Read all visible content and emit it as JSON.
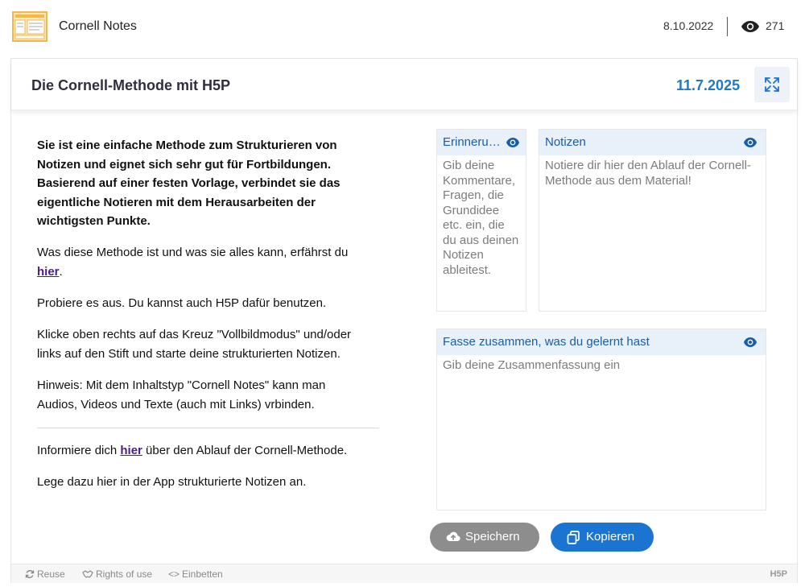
{
  "header": {
    "app_title": "Cornell Notes",
    "date": "8.10.2022",
    "view_count": "271",
    "icons": {
      "logo": "cornell-notes-logo-icon",
      "views": "eye-icon"
    }
  },
  "content": {
    "title": "Die Cornell-Methode mit H5P",
    "date": "11.7.2025"
  },
  "text": {
    "intro": "Sie ist eine einfache Methode zum Strukturieren von Notizen und eignet sich sehr gut für Fortbildungen. Basierend auf einer festen Vorlage, verbindet sie das eigentliche Notieren mit dem Herausarbeiten der wichtigsten Punkte.",
    "p2_before": "Was diese Methode ist und was sie alles kann, erfährst du ",
    "p2_link": "hier",
    "p2_after": ".",
    "p3": "Probiere es aus. Du kannst auch H5P dafür benutzen.",
    "p4": "Klicke oben rechts auf das Kreuz \"Vollbildmodus\" und/oder links auf den Stift und starte deine strukturierten Notizen.",
    "p5": "Hinweis: Mit dem Inhaltstyp \"Cornell Notes\" kann man Audios, Videos und Texte (auch mit Links) vrbinden.",
    "p6_before": "Informiere dich ",
    "p6_link": "hier",
    "p6_after": " über den Ablauf der Cornell-Methode.",
    "p7": "Lege dazu hier in der App strukturierte Notizen an."
  },
  "panels": {
    "recall": {
      "label": "Erinneru…",
      "placeholder": "Gib deine Kommentare, Fragen, die Grundidee etc. ein, die du aus deinen Notizen ableitest."
    },
    "notes": {
      "label": "Notizen",
      "placeholder": "Notiere dir hier den Ablauf der Cornell-Methode aus dem Material!"
    },
    "summary": {
      "label": "Fasse zusammen, was du gelernt hast",
      "placeholder": "Gib deine Zusammenfassung ein"
    }
  },
  "buttons": {
    "save": "Speichern",
    "copy": "Kopieren"
  },
  "footer": {
    "reuse": "Reuse",
    "rights": "Rights of use",
    "embed": "Einbetten",
    "logo": "H5P"
  },
  "colors": {
    "accent": "#1b74d2",
    "date_accent": "#1f79c5",
    "panel_header": "#e8f0fa",
    "save_button": "#8d8d8d",
    "link": "#4b1d83"
  }
}
